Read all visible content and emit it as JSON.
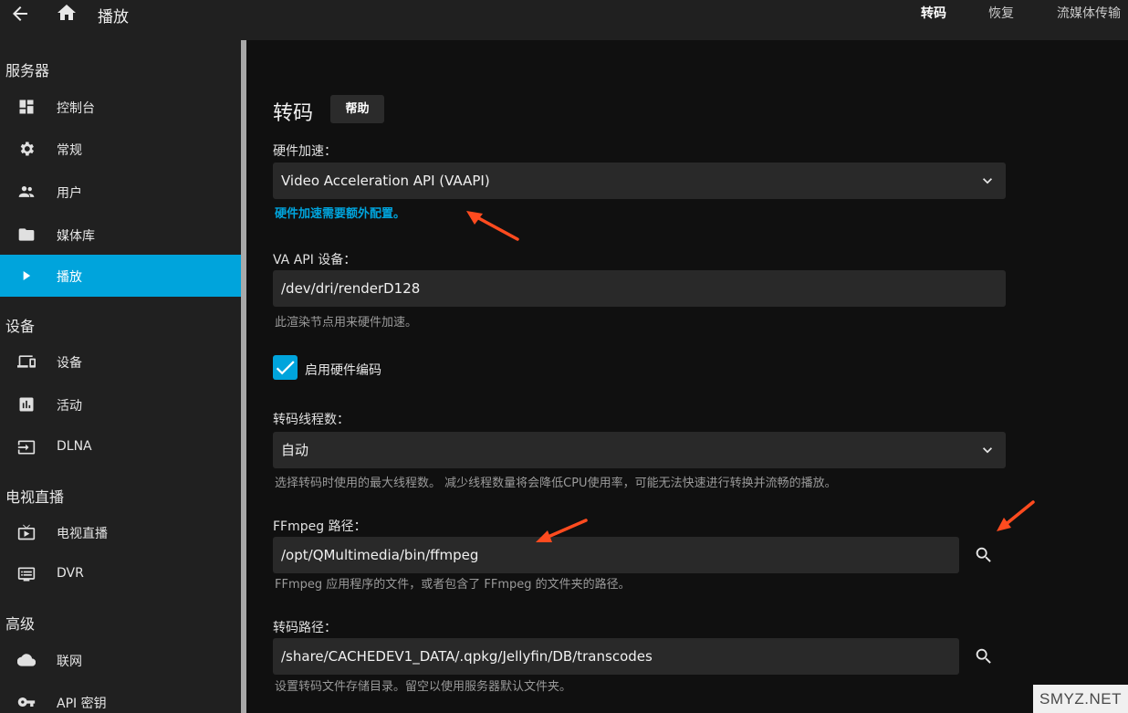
{
  "header": {
    "title": "播放",
    "tabs": [
      {
        "label": "转码",
        "active": true
      },
      {
        "label": "恢复",
        "active": false
      },
      {
        "label": "流媒体传输",
        "active": false
      }
    ]
  },
  "sidebar": {
    "sections": [
      {
        "title": "服务器",
        "items": [
          {
            "icon": "dashboard-icon",
            "label": "控制台"
          },
          {
            "icon": "gear-icon",
            "label": "常规"
          },
          {
            "icon": "users-icon",
            "label": "用户"
          },
          {
            "icon": "folder-icon",
            "label": "媒体库"
          },
          {
            "icon": "play-icon",
            "label": "播放",
            "active": true
          }
        ]
      },
      {
        "title": "设备",
        "items": [
          {
            "icon": "devices-icon",
            "label": "设备"
          },
          {
            "icon": "activity-icon",
            "label": "活动"
          },
          {
            "icon": "dlna-icon",
            "label": "DLNA"
          }
        ]
      },
      {
        "title": "电视直播",
        "items": [
          {
            "icon": "live-tv-icon",
            "label": "电视直播"
          },
          {
            "icon": "dvr-icon",
            "label": "DVR"
          }
        ]
      },
      {
        "title": "高级",
        "items": [
          {
            "icon": "cloud-icon",
            "label": "联网"
          },
          {
            "icon": "key-icon",
            "label": "API 密钥"
          }
        ]
      }
    ]
  },
  "main": {
    "title": "转码",
    "help_label": "帮助",
    "hw_accel": {
      "label": "硬件加速：",
      "value": "Video Acceleration API (VAAPI)",
      "note": "硬件加速需要额外配置。"
    },
    "vaapi_device": {
      "label": "VA API 设备：",
      "value": "/dev/dri/renderD128",
      "hint": "此渲染节点用来硬件加速。"
    },
    "enable_hw_encoding": {
      "label": "启用硬件编码",
      "checked": true
    },
    "threads": {
      "label": "转码线程数：",
      "value": "自动",
      "hint": "选择转码时使用的最大线程数。 减少线程数量将会降低CPU使用率，可能无法快速进行转换并流畅的播放。"
    },
    "ffmpeg_path": {
      "label": "FFmpeg 路径：",
      "value": "/opt/QMultimedia/bin/ffmpeg",
      "hint": "FFmpeg 应用程序的文件，或者包含了 FFmpeg 的文件夹的路径。"
    },
    "transcode_path": {
      "label": "转码路径：",
      "value": "/share/CACHEDEV1_DATA/.qpkg/Jellyfin/DB/transcodes",
      "hint": "设置转码文件存储目录。留空以使用服务器默认文件夹。"
    }
  },
  "watermark": "SMYZ.NET",
  "colors": {
    "accent": "#00a4dc",
    "sidebar_bg": "#202020",
    "page_bg": "#101010",
    "field_bg": "#292929",
    "annotation_arrow": "#ff4b1f"
  }
}
